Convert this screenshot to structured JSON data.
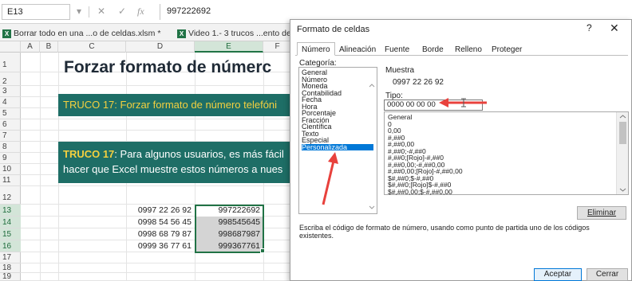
{
  "formula_bar": {
    "name_box": "E13",
    "dropdown_glyph": "▾",
    "cancel_glyph": "✕",
    "enter_glyph": "✓",
    "fx_label": "fx",
    "value": "997222692"
  },
  "workbook_tabs": [
    {
      "label": "Borrar todo en una ...o de celdas.xlsm *"
    },
    {
      "label": "Video 1.- 3 trucos ...ento de"
    }
  ],
  "sheet": {
    "columns": [
      "A",
      "B",
      "C",
      "D",
      "E",
      "F"
    ],
    "rows": [
      "1",
      "2",
      "3",
      "4",
      "5",
      "6",
      "7",
      "8",
      "9",
      "10",
      "11",
      "12",
      "13",
      "14",
      "15",
      "16",
      "17",
      "18",
      "19"
    ],
    "title": "Forzar formato de númerc",
    "truco1": "TRUCO 17: Forzar formato de número telefóni",
    "truco2_bold": "TRUCO 17",
    "truco2_line1": ": Para algunos usuarios, es más fácil",
    "truco2_line2": "hacer que Excel muestre estos números a nues",
    "col_d": [
      "0997 22 26 92",
      "0998 54 56 45",
      "0998 68 79 87",
      "0999 36 77 61"
    ],
    "col_e": [
      "997222692",
      "998545645",
      "998687987",
      "999367761"
    ],
    "colors": {
      "teal": "#1e6e66",
      "yellow": "#f4d03f",
      "selection": "#217346"
    }
  },
  "dialog": {
    "title": "Formato de celdas",
    "help": "?",
    "close": "✕",
    "tabs": [
      "Número",
      "Alineación",
      "Fuente",
      "Borde",
      "Relleno",
      "Proteger"
    ],
    "active_tab": "Número",
    "category_label": "Categoría:",
    "categories": [
      "General",
      "Número",
      "Moneda",
      "Contabilidad",
      "Fecha",
      "Hora",
      "Porcentaje",
      "Fracción",
      "Científica",
      "Texto",
      "Especial",
      "Personalizada"
    ],
    "selected_category": "Personalizada",
    "muestra_label": "Muestra",
    "muestra_value": "0997 22 26 92",
    "tipo_label": "Tipo:",
    "tipo_value": "0000 00 00 00",
    "formats": [
      "General",
      "0",
      "0,00",
      "#,##0",
      "#,##0,00",
      "#,##0;-#,##0",
      "#,##0;[Rojo]-#,##0",
      "#,##0,00;-#,##0,00",
      "#,##0,00;[Rojo]-#,##0,00",
      "$#,##0;$-#,##0",
      "$#,##0;[Rojo]$-#,##0",
      "$#,##0,00;$-#,##0,00"
    ],
    "eliminar": "Eliminar",
    "description": "Escriba el código de formato de número, usando como punto de partida uno de los códigos existentes.",
    "accept": "Aceptar",
    "close_button": "Cerrar",
    "arrow_color": "#e8413c"
  }
}
